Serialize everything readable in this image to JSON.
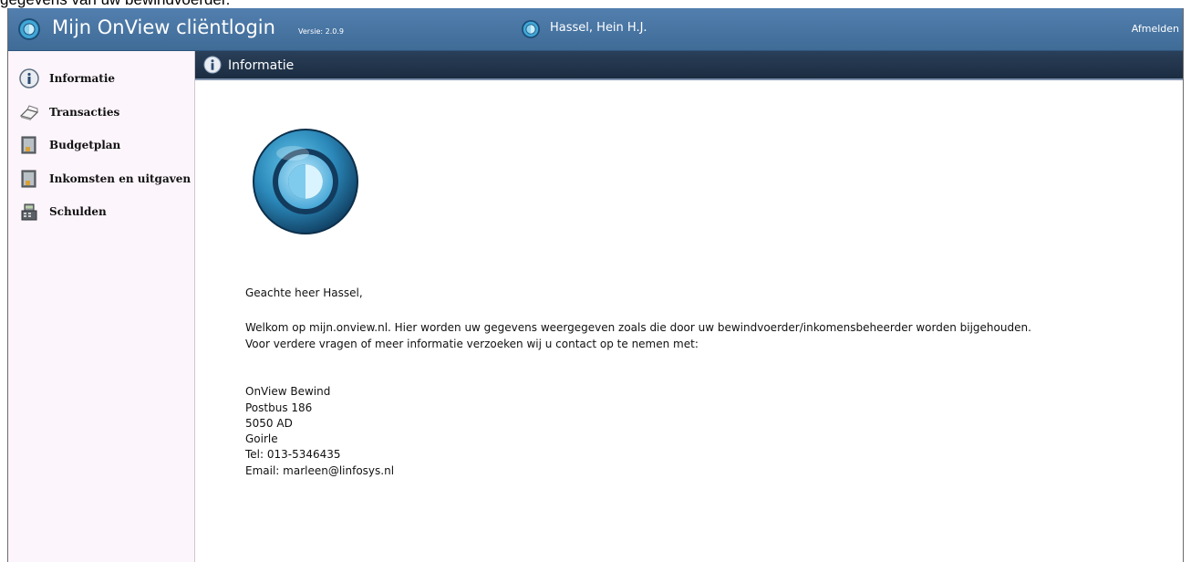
{
  "page_caption": "gegevens van uw bewindvoerder.",
  "header": {
    "app_title": "Mijn OnView cliëntlogin",
    "version": "Versie: 2.0.9",
    "user_name": "Hassel, Hein H.J.",
    "logout_label": "Afmelden",
    "bar_color": "#4a76a3"
  },
  "sidebar": {
    "items": [
      {
        "label": "Informatie",
        "icon": "info-icon"
      },
      {
        "label": "Transacties",
        "icon": "book-icon"
      },
      {
        "label": "Budgetplan",
        "icon": "ledger-icon"
      },
      {
        "label": "Inkomsten en uitgaven",
        "icon": "ledger-icon"
      },
      {
        "label": "Schulden",
        "icon": "cash-register-icon"
      }
    ]
  },
  "panel": {
    "title": "Informatie",
    "greeting": "Geachte heer Hassel,",
    "welcome_line1": "Welkom op mijn.onview.nl. Hier worden uw gegevens weergegeven zoals die door uw bewindvoerder/inkomensbeheerder worden bijgehouden.",
    "welcome_line2": "Voor verdere vragen of meer informatie verzoeken wij u contact op te nemen met:",
    "contact": {
      "name": "OnView Bewind",
      "address": "Postbus 186",
      "postal_code": "5050 AD",
      "city": "Goirle",
      "phone": "Tel: 013-5346435",
      "email": "Email: marleen@linfosys.nl"
    }
  }
}
